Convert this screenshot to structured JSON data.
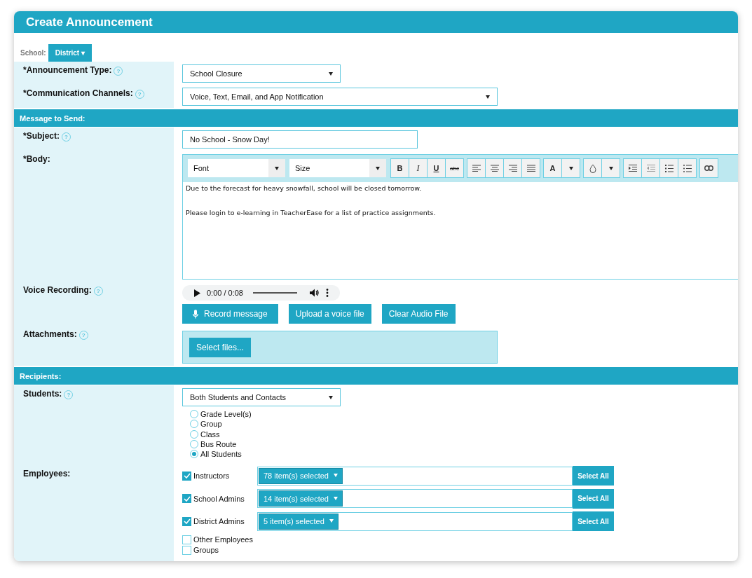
{
  "title": "Create Announcement",
  "school": {
    "label": "School:",
    "value": "District",
    "caret": "▾"
  },
  "announcement_type": {
    "label": "*Announcement Type:",
    "help": "?",
    "value": "School Closure"
  },
  "communication_channels": {
    "label": "*Communication Channels:",
    "help": "?",
    "value": "Voice, Text, Email, and App Notification"
  },
  "message_section": {
    "title": "Message to Send:"
  },
  "subject": {
    "label": "*Subject:",
    "help": "?",
    "value": "No School - Snow Day!"
  },
  "body": {
    "label": "*Body:",
    "font_select": "Font",
    "size_select": "Size",
    "format_buttons": [
      "B",
      "I",
      "U",
      "abc"
    ],
    "color_button": "A",
    "paragraphs": [
      "Due to the forecast for heavy snowfall, school will be closed tomorrow.",
      "Please login to e-learning in TeacherEase for a list of practice assignments."
    ]
  },
  "voice_recording": {
    "label": "Voice Recording:",
    "help": "?",
    "time": "0:00 / 0:08",
    "buttons": [
      {
        "label": "Record message",
        "kind": "record"
      },
      {
        "label": "Upload a voice file",
        "kind": "plain"
      },
      {
        "label": "Clear Audio File",
        "kind": "plain"
      }
    ]
  },
  "attachments": {
    "label": "Attachments:",
    "help": "?",
    "button": "Select files..."
  },
  "recipients_section": {
    "title": "Recipients:"
  },
  "students": {
    "label": "Students:",
    "help": "?",
    "value": "Both Students and Contacts",
    "options": [
      {
        "label": "Grade Level(s)",
        "selected": false
      },
      {
        "label": "Group",
        "selected": false
      },
      {
        "label": "Class",
        "selected": false
      },
      {
        "label": "Bus Route",
        "selected": false
      },
      {
        "label": "All Students",
        "selected": true
      }
    ]
  },
  "employees": {
    "label": "Employees:",
    "items": [
      {
        "label": "Instructors",
        "checked": true,
        "selection": "78 item(s) selected",
        "select_all": "Select All"
      },
      {
        "label": "School Admins",
        "checked": true,
        "selection": "14 item(s) selected",
        "select_all": "Select All"
      },
      {
        "label": "District Admins",
        "checked": true,
        "selection": "5 item(s) selected",
        "select_all": "Select All"
      },
      {
        "label": "Other Employees",
        "checked": false
      },
      {
        "label": "Groups",
        "checked": false
      }
    ]
  }
}
